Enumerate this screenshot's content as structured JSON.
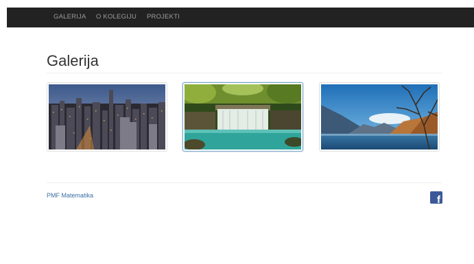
{
  "navbar": {
    "items": [
      {
        "label": "GALERIJA"
      },
      {
        "label": "O KOLEGIJU"
      },
      {
        "label": "PROJEKTI"
      }
    ]
  },
  "main": {
    "title": "Galerija",
    "gallery": [
      {
        "subject": "city-skyline-night"
      },
      {
        "subject": "waterfall-forest"
      },
      {
        "subject": "mountain-lake"
      }
    ]
  },
  "footer": {
    "link_text": "PMF Matematika",
    "social_icon": "facebook-icon",
    "social_glyph": "f"
  },
  "colors": {
    "navbar_bg": "#222222",
    "nav_text": "#9d9d9d",
    "link": "#3a6fa5",
    "facebook": "#3b5998"
  }
}
